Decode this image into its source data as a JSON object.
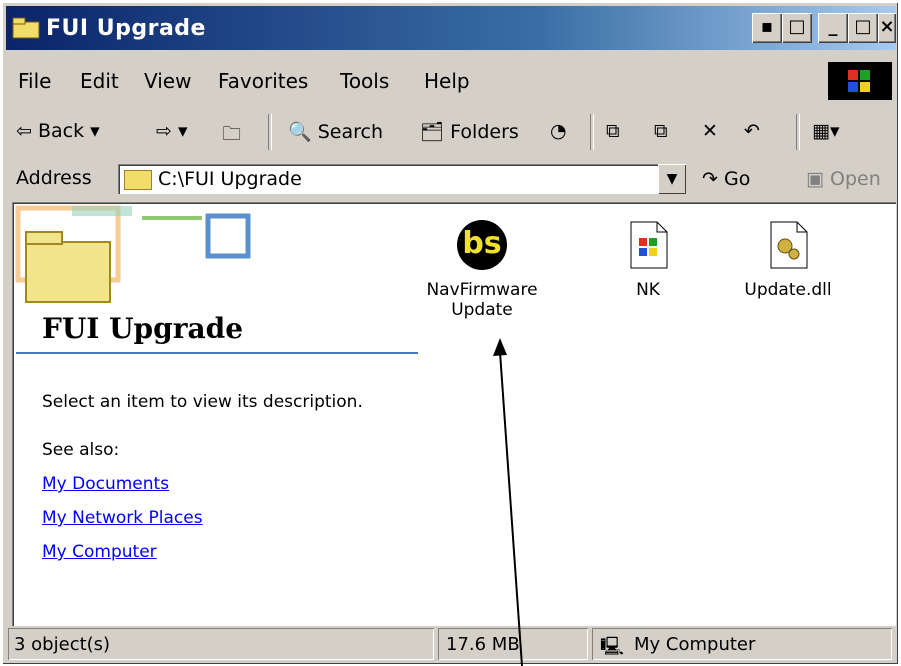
{
  "window": {
    "title": "FUI Upgrade"
  },
  "menu": [
    "File",
    "Edit",
    "View",
    "Favorites",
    "Tools",
    "Help"
  ],
  "toolbar": {
    "back": "Back",
    "search": "Search",
    "folders": "Folders"
  },
  "address": {
    "label": "Address",
    "value": "C:\\FUI Upgrade",
    "go": "Go",
    "open": "Open"
  },
  "panel": {
    "title": "FUI Upgrade",
    "description": "Select an item to view its description.",
    "see_also": "See also:",
    "links": [
      "My Documents",
      "My Network Places",
      "My Computer"
    ]
  },
  "files": [
    {
      "name": "NavFirmwareUpdate",
      "icon": "bs-app-icon",
      "icon_text": "bs"
    },
    {
      "name": "NK",
      "icon": "image-file-icon"
    },
    {
      "name": "Update.dll",
      "icon": "dll-gear-icon"
    }
  ],
  "status": {
    "objects": "3 object(s)",
    "size": "17.6 MB",
    "zone": "My Computer"
  }
}
